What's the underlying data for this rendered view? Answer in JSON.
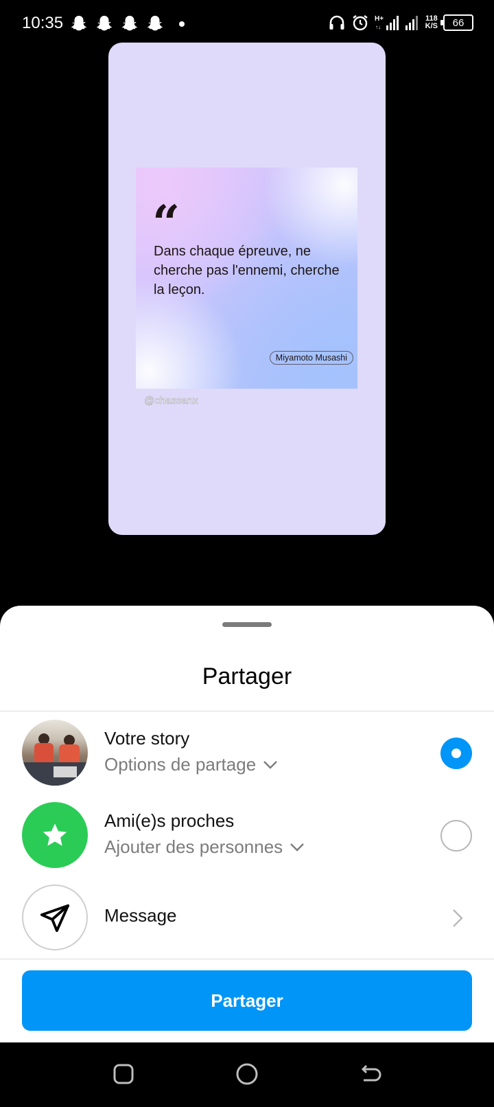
{
  "status_bar": {
    "time": "10:35",
    "net_speed_value": "118",
    "net_speed_unit": "K/S",
    "battery": "66",
    "icons": [
      "snapchat-icon",
      "snapchat-icon",
      "snapchat-icon",
      "snapchat-icon",
      "dot-icon",
      "headphones-icon",
      "alarm-icon",
      "signal-icon",
      "signal-icon",
      "battery-icon"
    ]
  },
  "preview": {
    "background_color": "#dfdaf9",
    "quote_mark": "“",
    "quote_text": "Dans chaque épreuve, ne cherche pas l'ennemi, cherche la leçon.",
    "author": "Miyamoto Musashi",
    "watermark": "@chassanx"
  },
  "sheet": {
    "title": "Partager",
    "options": [
      {
        "title": "Votre story",
        "subtitle": "Options de partage",
        "icon": "profile-photo",
        "selected": true
      },
      {
        "title": "Ami(e)s proches",
        "subtitle": "Ajouter des personnes",
        "icon": "star-icon",
        "selected": false
      },
      {
        "title": "Message",
        "icon": "paper-plane-icon"
      }
    ],
    "share_button": "Partager"
  },
  "colors": {
    "accent": "#0095f6",
    "close_friends": "#2bcc56",
    "sheet_background": "#ffffff",
    "secondary_text": "#7c7c7c"
  },
  "nav_bar": {
    "icons": [
      "recent-apps-icon",
      "home-icon",
      "back-icon"
    ]
  }
}
